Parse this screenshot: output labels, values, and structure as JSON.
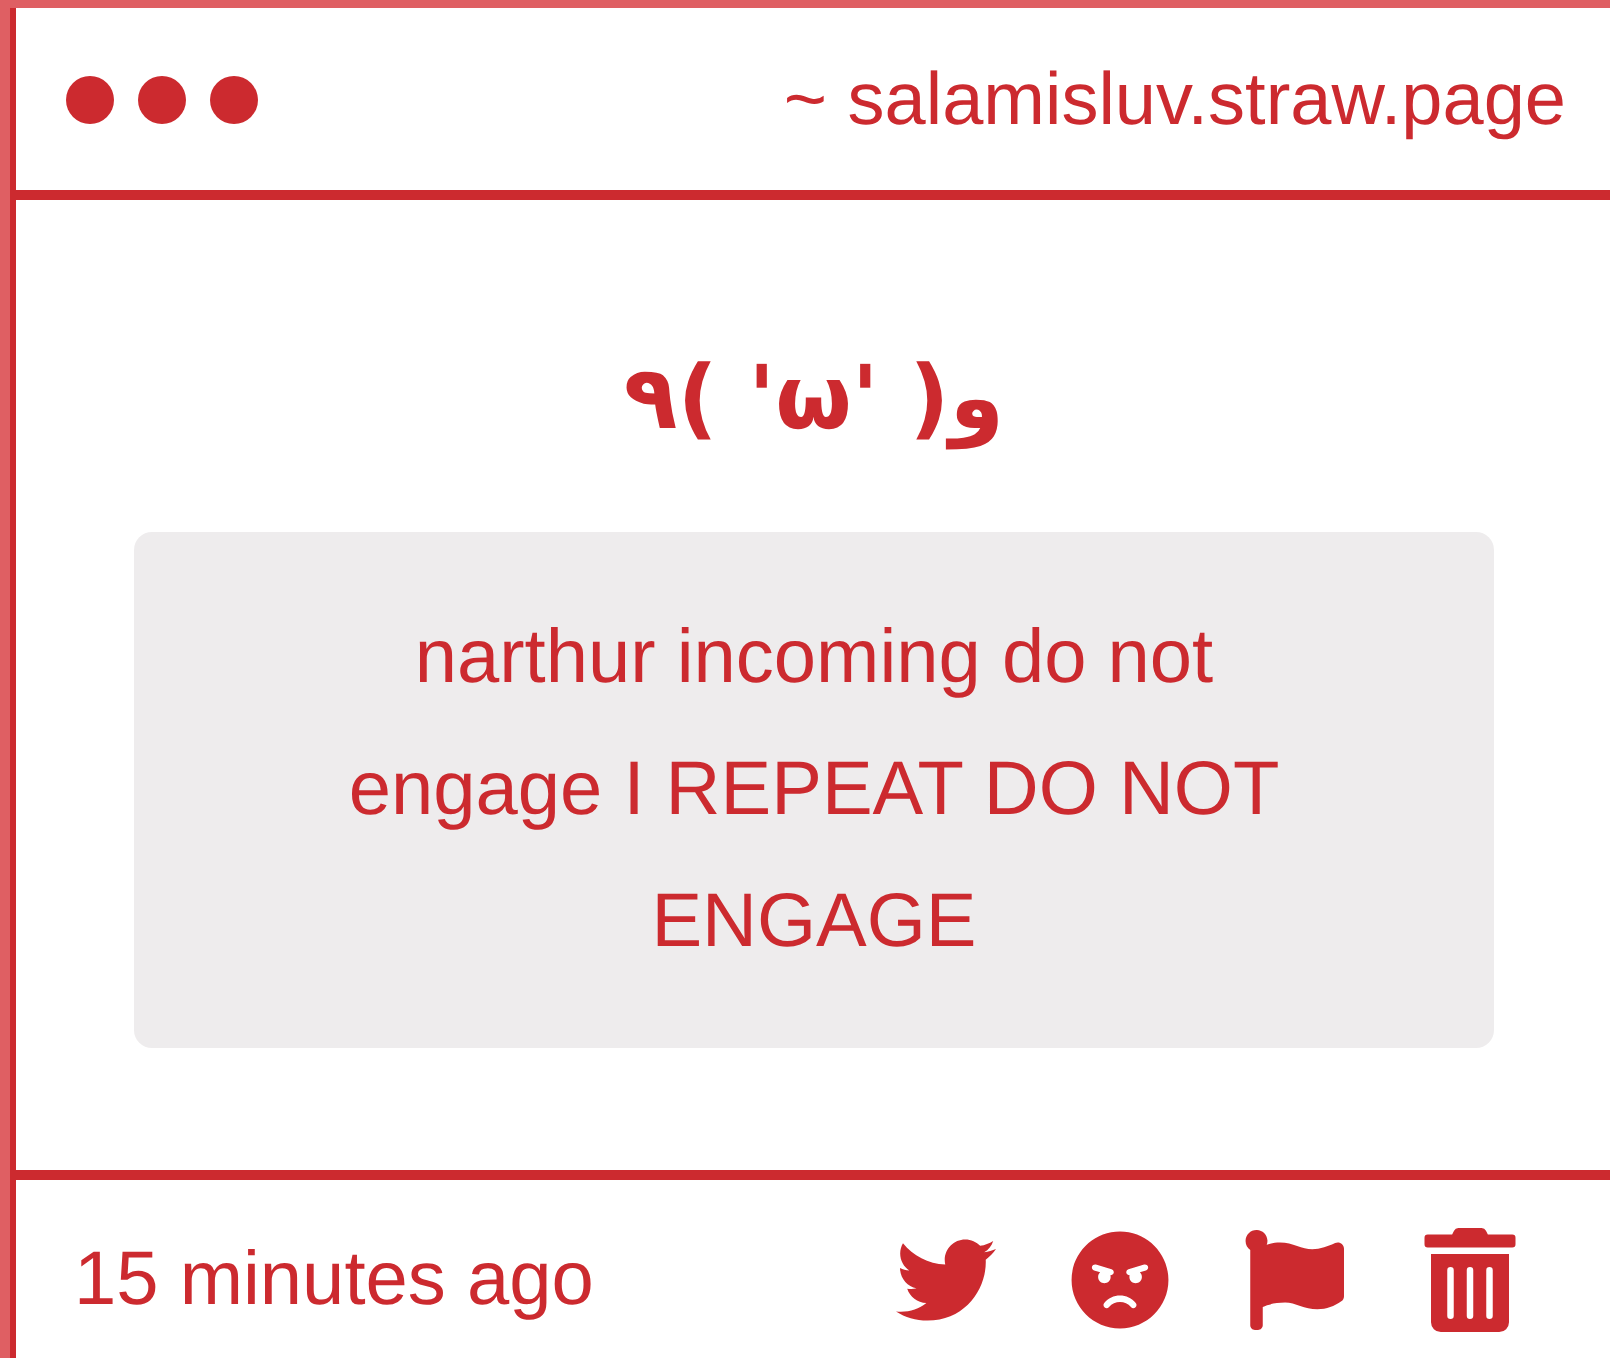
{
  "window": {
    "title": "~ salamisluv.straw.page"
  },
  "post": {
    "kaomoji": "٩( 'ω' )و",
    "message": "narthur incoming do not engage I REPEAT DO NOT ENGAGE"
  },
  "footer": {
    "timestamp": "15 minutes ago"
  }
}
